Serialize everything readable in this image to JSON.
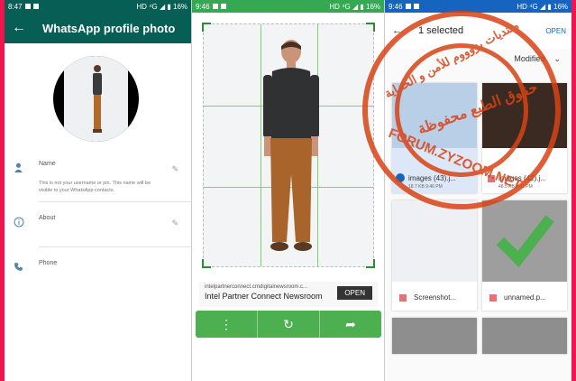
{
  "colors": {
    "whatsapp_green": "#075e54",
    "crop_green": "#34a853",
    "frame_red": "#f0154e",
    "accent_blue": "#1565c0"
  },
  "panel1": {
    "status_time": "8:47",
    "status_right": "HD ⁴G ◢ ▮ 16%",
    "title": "WhatsApp profile photo",
    "name_label": "Name",
    "name_hint": "This is not your username or pin. This name will be visible to your WhatsApp contacts.",
    "about_label": "About",
    "phone_label": "Phone"
  },
  "panel2": {
    "status_time": "9:46",
    "status_right": "HD ⁴G ◢ ▮ 16%",
    "ad_url": "intelpartnerconnect.crndigitalnewsroom.c...",
    "ad_title": "Intel Partner Connect Newsroom",
    "ad_button": "OPEN",
    "icons": [
      "more-vert-icon",
      "rotate-icon",
      "share-icon"
    ]
  },
  "panel3": {
    "status_time": "9:46",
    "status_right": "HD ⁴G ◢ ▮ 16%",
    "header_title": "1 selected",
    "header_action": "OPEN",
    "sort_label": "Modified",
    "tiles": [
      {
        "caption": "images (43).j...",
        "sub": "18.7 KB 9:46 PM"
      },
      {
        "caption": "images (42).j...",
        "sub": "48.5 KB 9:41 PM"
      },
      {
        "caption": "Screenshot..."
      },
      {
        "caption": "unnamed.p..."
      }
    ]
  },
  "watermark": {
    "arabic": "منتديات يزوووم للأمن و الحماية",
    "center": "حقوق الطبع محفوظة",
    "url": "FORUM.ZYZOOM.NET"
  }
}
